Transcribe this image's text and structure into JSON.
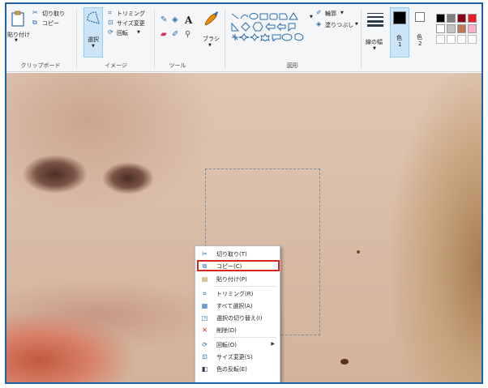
{
  "ribbon": {
    "clipboard": {
      "paste_label": "貼り付け",
      "cut_label": "切り取り",
      "copy_label": "コピー",
      "group_label": "クリップボード"
    },
    "image": {
      "select_label": "選択",
      "crop_label": "トリミング",
      "resize_label": "サイズ変更",
      "rotate_label": "回転",
      "group_label": "イメージ"
    },
    "tools": {
      "group_label": "ツール",
      "text_tool": "A"
    },
    "brush": {
      "label": "ブラシ"
    },
    "shapes": {
      "outline_label": "輪郭",
      "fill_label": "塗りつぶし",
      "group_label": "図形"
    },
    "size": {
      "label": "線の幅"
    },
    "colors": {
      "color1_label": "色",
      "color1_num": "1",
      "color2_label": "色",
      "color2_num": "2",
      "color1_value": "#000000",
      "color2_value": "#ffffff",
      "palette": [
        "#000000",
        "#7f7f7f",
        "#880015",
        "#ed1c24",
        "#ffffff",
        "#c3c3c3",
        "#b97a57",
        "#ffaec9"
      ]
    }
  },
  "context_menu": {
    "items": [
      {
        "icon": "scissors-icon",
        "label": "切り取り(T)"
      },
      {
        "icon": "copy-icon",
        "label": "コピー(C)",
        "highlighted": true
      },
      {
        "icon": "paste-icon",
        "label": "貼り付け(P)"
      },
      {
        "icon": "crop-icon",
        "label": "トリミング(R)"
      },
      {
        "icon": "select-all-icon",
        "label": "すべて選択(A)"
      },
      {
        "icon": "invert-selection-icon",
        "label": "選択の切り替え(I)"
      },
      {
        "icon": "delete-icon",
        "label": "削除(D)"
      },
      {
        "icon": "rotate-icon",
        "label": "回転(O)",
        "has_submenu": true
      },
      {
        "icon": "resize-icon",
        "label": "サイズ変更(S)"
      },
      {
        "icon": "invert-color-icon",
        "label": "色の反転(E)"
      }
    ],
    "highlight_color": "#d9261c"
  }
}
